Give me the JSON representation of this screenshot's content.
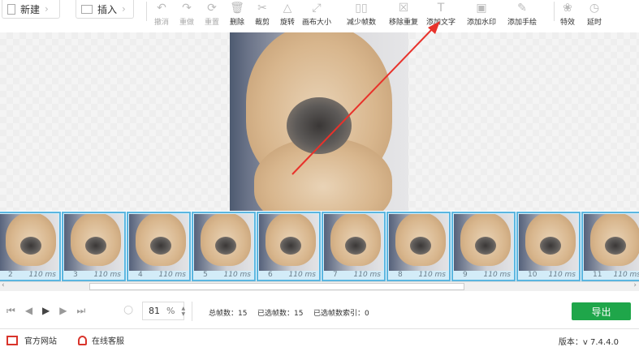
{
  "toolbar": {
    "new_label": "新建",
    "insert_label": "插入",
    "tools": [
      {
        "label": "撤消",
        "icon": "undo-icon",
        "enabled": false
      },
      {
        "label": "重做",
        "icon": "redo-icon",
        "enabled": false
      },
      {
        "label": "重置",
        "icon": "reset-icon",
        "enabled": false
      },
      {
        "label": "删除",
        "icon": "trash-icon",
        "enabled": true
      },
      {
        "label": "裁剪",
        "icon": "scissors-icon",
        "enabled": true
      },
      {
        "label": "旋转",
        "icon": "rotate-icon",
        "enabled": true
      },
      {
        "label": "画布大小",
        "icon": "resize-icon",
        "enabled": true
      },
      {
        "label": "减少帧数",
        "icon": "reduce-frames-icon",
        "enabled": true
      },
      {
        "label": "移除重复",
        "icon": "remove-duplicate-icon",
        "enabled": true
      },
      {
        "label": "添加文字",
        "icon": "text-icon",
        "enabled": true
      },
      {
        "label": "添加水印",
        "icon": "watermark-icon",
        "enabled": true
      },
      {
        "label": "添加手绘",
        "icon": "pencil-icon",
        "enabled": true
      },
      {
        "label": "特效",
        "icon": "effects-icon",
        "enabled": true
      },
      {
        "label": "延时",
        "icon": "timer-icon",
        "enabled": true
      }
    ]
  },
  "frames": [
    {
      "n": "2",
      "ms": "110 ms"
    },
    {
      "n": "3",
      "ms": "110 ms"
    },
    {
      "n": "4",
      "ms": "110 ms"
    },
    {
      "n": "5",
      "ms": "110 ms"
    },
    {
      "n": "6",
      "ms": "110 ms"
    },
    {
      "n": "7",
      "ms": "110 ms"
    },
    {
      "n": "8",
      "ms": "110 ms"
    },
    {
      "n": "9",
      "ms": "110 ms"
    },
    {
      "n": "10",
      "ms": "110 ms"
    },
    {
      "n": "11",
      "ms": "110 ms"
    }
  ],
  "controls": {
    "zoom_value": "81",
    "zoom_unit": "%",
    "total_frames": "总帧数：15",
    "selected_frames": "已选帧数：15",
    "selected_index": "已选帧数索引：0",
    "export_label": "导出"
  },
  "footer": {
    "website": "官方网站",
    "support": "在线客服",
    "version": "版本：v 7.4.4.0"
  },
  "colors": {
    "accent": "#1fa64a",
    "frame_border": "#5bb6e0",
    "arrow": "#e8322b"
  }
}
